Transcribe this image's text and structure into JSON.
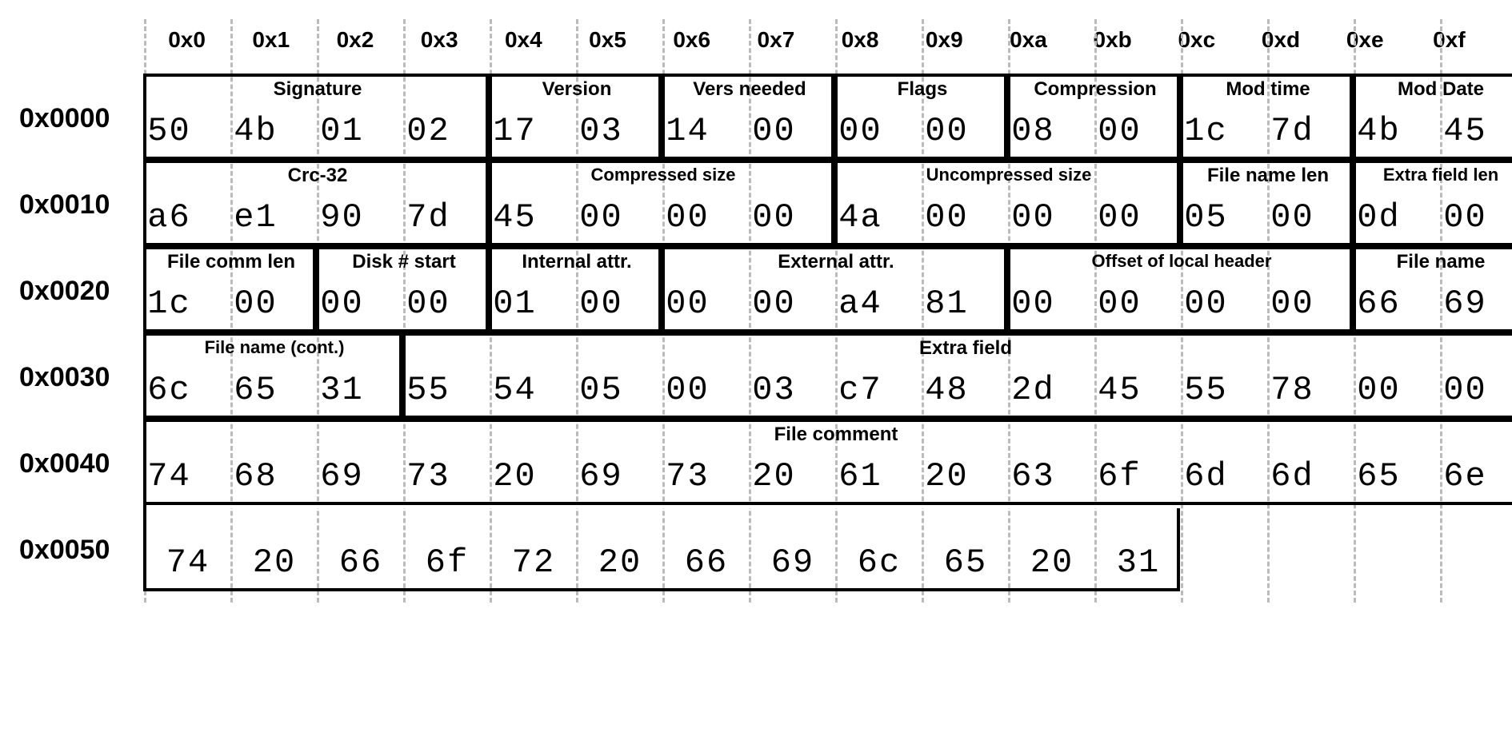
{
  "columns": [
    "0x0",
    "0x1",
    "0x2",
    "0x3",
    "0x4",
    "0x5",
    "0x6",
    "0x7",
    "0x8",
    "0x9",
    "0xa",
    "0xb",
    "0xc",
    "0xd",
    "0xe",
    "0xf"
  ],
  "rows": [
    {
      "offset": "0x0000",
      "bytes": [
        "50",
        "4b",
        "01",
        "02",
        "17",
        "03",
        "14",
        "00",
        "00",
        "00",
        "08",
        "00",
        "1c",
        "7d",
        "4b",
        "45"
      ]
    },
    {
      "offset": "0x0010",
      "bytes": [
        "a6",
        "e1",
        "90",
        "7d",
        "45",
        "00",
        "00",
        "00",
        "4a",
        "00",
        "00",
        "00",
        "05",
        "00",
        "0d",
        "00"
      ]
    },
    {
      "offset": "0x0020",
      "bytes": [
        "1c",
        "00",
        "00",
        "00",
        "01",
        "00",
        "00",
        "00",
        "a4",
        "81",
        "00",
        "00",
        "00",
        "00",
        "66",
        "69"
      ]
    },
    {
      "offset": "0x0030",
      "bytes": [
        "6c",
        "65",
        "31",
        "55",
        "54",
        "05",
        "00",
        "03",
        "c7",
        "48",
        "2d",
        "45",
        "55",
        "78",
        "00",
        "00"
      ]
    },
    {
      "offset": "0x0040",
      "bytes": [
        "74",
        "68",
        "69",
        "73",
        "20",
        "69",
        "73",
        "20",
        "61",
        "20",
        "63",
        "6f",
        "6d",
        "6d",
        "65",
        "6e"
      ]
    },
    {
      "offset": "0x0050",
      "bytes": [
        "74",
        "20",
        "66",
        "6f",
        "72",
        "20",
        "66",
        "69",
        "6c",
        "65",
        "20",
        "31"
      ]
    }
  ],
  "fields": [
    {
      "label": "Signature",
      "row": 0,
      "col": 0,
      "span": 4
    },
    {
      "label": "Version",
      "row": 0,
      "col": 4,
      "span": 2
    },
    {
      "label": "Vers needed",
      "row": 0,
      "col": 6,
      "span": 2
    },
    {
      "label": "Flags",
      "row": 0,
      "col": 8,
      "span": 2
    },
    {
      "label": "Compression",
      "row": 0,
      "col": 10,
      "span": 2
    },
    {
      "label": "Mod time",
      "row": 0,
      "col": 12,
      "span": 2
    },
    {
      "label": "Mod Date",
      "row": 0,
      "col": 14,
      "span": 2
    },
    {
      "label": "Crc-32",
      "row": 1,
      "col": 0,
      "span": 4
    },
    {
      "label": "Compressed size",
      "row": 1,
      "col": 4,
      "span": 4
    },
    {
      "label": "Uncompressed size",
      "row": 1,
      "col": 8,
      "span": 4
    },
    {
      "label": "File name len",
      "row": 1,
      "col": 12,
      "span": 2
    },
    {
      "label": "Extra field len",
      "row": 1,
      "col": 14,
      "span": 2
    },
    {
      "label": "File comm len",
      "row": 2,
      "col": 0,
      "span": 2
    },
    {
      "label": "Disk # start",
      "row": 2,
      "col": 2,
      "span": 2
    },
    {
      "label": "Internal attr.",
      "row": 2,
      "col": 4,
      "span": 2
    },
    {
      "label": "External attr.",
      "row": 2,
      "col": 6,
      "span": 4
    },
    {
      "label": "Offset of local header",
      "row": 2,
      "col": 10,
      "span": 4
    },
    {
      "label": "File name",
      "row": 2,
      "col": 14,
      "span": 2
    },
    {
      "label": "File name (cont.)",
      "row": 3,
      "col": 0,
      "span": 3
    },
    {
      "label": "Extra  field",
      "row": 3,
      "col": 3,
      "span": 13
    },
    {
      "label": "File comment",
      "row": 4,
      "col": 0,
      "span": 16
    }
  ]
}
